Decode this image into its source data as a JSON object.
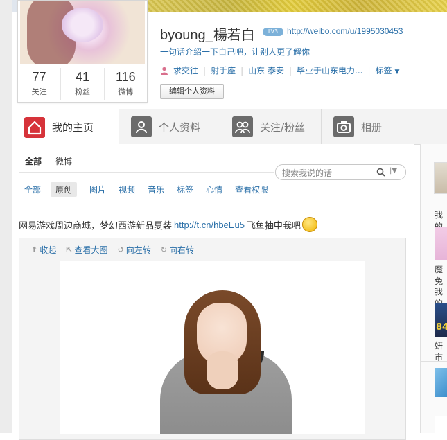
{
  "profile": {
    "name": "byoung_楊若白",
    "badge": "LV3",
    "url": "http://weibo.com/u/1995030453",
    "intro": "一句话介绍一下自己吧，让别人更了解你",
    "info": [
      "求交往",
      "射手座",
      "山东 泰安",
      "毕业于山东电力..."
    ],
    "tags_label": "标签",
    "edit_button": "编辑个人资料",
    "stats": [
      {
        "num": "77",
        "label": "关注"
      },
      {
        "num": "41",
        "label": "粉丝"
      },
      {
        "num": "116",
        "label": "微博"
      }
    ]
  },
  "tabs": [
    {
      "label": "我的主页",
      "icon": "home-icon",
      "active": true
    },
    {
      "label": "个人资料",
      "icon": "person-icon",
      "active": false
    },
    {
      "label": "关注/粉丝",
      "icon": "people-icon",
      "active": false
    },
    {
      "label": "相册",
      "icon": "camera-icon",
      "active": false
    }
  ],
  "filter_primary": [
    "全部",
    "微博"
  ],
  "search": {
    "placeholder": "搜索我说的话"
  },
  "filter_secondary": [
    "全部",
    "原创",
    "图片",
    "视频",
    "音乐",
    "标签",
    "心情",
    "查看权限"
  ],
  "post": {
    "text": "网易游戏周边商城，梦幻西游新品夏装",
    "link": "http://t.cn/hbeEu5",
    "tail": "飞鱼抽中我吧"
  },
  "media_toolbar": [
    "收起",
    "查看大图",
    "向左转",
    "向右转"
  ],
  "sidebar": {
    "label1": "我的",
    "label2": "魔兔",
    "label3": "我的",
    "label4": "妍市"
  },
  "colors": {
    "accent": "#d6333a",
    "link": "#2a6fa8"
  }
}
